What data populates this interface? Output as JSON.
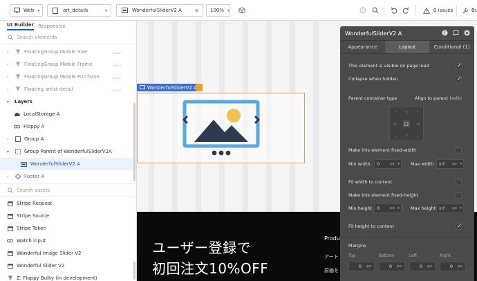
{
  "topbar": {
    "platform": "Web",
    "page": "art_details",
    "element": "WonderfulSliderV2 A",
    "zoom": "100%",
    "issues": "0 issues",
    "bui": "Bui"
  },
  "left": {
    "tabs": [
      {
        "label": "UI Builder"
      },
      {
        "label": "Responsive"
      }
    ],
    "search_placeholder": "Search elements",
    "top_items": [
      {
        "label": "FloatingGroup Mobile Size"
      },
      {
        "label": "FloatingGroup Mobile Frame"
      },
      {
        "label": "FloatingGroup Mobile Purchase"
      },
      {
        "label": "Floating artist detail"
      }
    ],
    "layers_label": "Layers",
    "layers": [
      {
        "label": "LocalStorage A"
      },
      {
        "label": "Floppy A"
      },
      {
        "label": "Group A"
      },
      {
        "label": "Group Parent of WonderfulSliderV2A"
      },
      {
        "label": "WonderfulSliderV2 A"
      },
      {
        "label": "Footer A"
      }
    ],
    "assets_placeholder": "Search assets",
    "assets": [
      {
        "label": "Stripe Request"
      },
      {
        "label": "Stripe Source"
      },
      {
        "label": "Stripe Token"
      },
      {
        "label": "Watch input"
      },
      {
        "label": "Wonderful Image Slider V2"
      },
      {
        "label": "Wonderful Slider V2"
      },
      {
        "label": "Z: Floppy Bulky (in development)"
      }
    ]
  },
  "canvas": {
    "element_label": "WonderfulSliderV2 A",
    "jp_line1": "ユーザー登録で",
    "jp_line2": "初回注文10%OFF",
    "product_heading": "Produ",
    "text1": "アート",
    "text2": "原画を"
  },
  "props": {
    "title": "WonderfulSliderV2 A",
    "tabs": [
      {
        "label": "Appearance"
      },
      {
        "label": "Layout"
      },
      {
        "label": "Conditional (1)"
      }
    ],
    "visible_label": "This element is visible on page load",
    "collapse_label": "Collapse when hidden",
    "parent_container_label": "Parent container type",
    "parent_container_value": "Align to parent",
    "parent_container_edit": "(edit)",
    "fixed_width_label": "Make this element fixed-width",
    "min_width_label": "Min width",
    "min_width_value": "0",
    "max_width_label": "Max width",
    "max_width_value": "inf",
    "fit_width_label": "Fit width to content",
    "fixed_height_label": "Make this element fixed-height",
    "min_height_label": "Min height",
    "min_height_value": "0",
    "max_height_label": "Max height",
    "max_height_value": "inf",
    "fit_height_label": "Fit height to content",
    "margins_label": "Margins",
    "margin_top_label": "Top",
    "margin_bottom_label": "Bottom",
    "margin_left_label": "Left",
    "margin_right_label": "Right",
    "margin_top_value": "0",
    "margin_bottom_value": "0",
    "margin_left_value": "0",
    "margin_right_value": "0",
    "unit": "px"
  },
  "colors": {
    "accent": "#3b6fd6",
    "panel": "#4a4a4a",
    "image_icon_blue": "#58a8e6",
    "image_icon_sun": "#f2c14e"
  }
}
